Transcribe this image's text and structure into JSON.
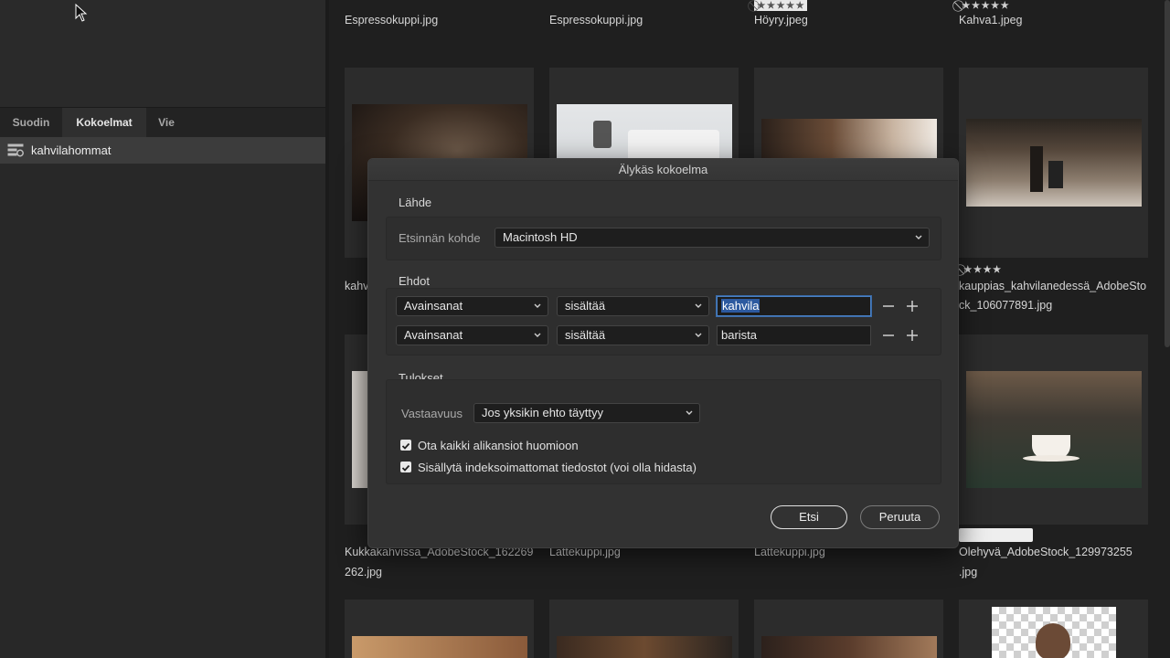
{
  "left_panel": {
    "tabs": [
      "Suodin",
      "Kokoelmat",
      "Vie"
    ],
    "active_tab": "Kokoelmat",
    "collection_item": "kahvilahommat"
  },
  "grid": {
    "row1_names": [
      "Espressokuppi.jpg",
      "Espressokuppi.jpg",
      "Höyry.jpeg",
      "Kahva1.jpeg"
    ],
    "row2_name_col0": "kahv",
    "row2_name_col3_line1": "kauppias_kahvilanedessä_AdobeSto",
    "row2_name_col3_line2": "ck_106077891.jpg",
    "row3_name_col0_line1": "Kukkakahvissa_AdobeStock_162269",
    "row3_name_col0_line2": "262.jpg",
    "row3_name_col1": "Lattekuppi.jpg",
    "row3_name_col2": "Lattekuppi.jpg",
    "row3_name_col3_line1": "Olehyvä_AdobeStock_129973255",
    "row3_name_col3_line2": ".jpg",
    "stars_glyph": "⃠★★★★★",
    "stars_glyph_4": "⃠★★★★"
  },
  "dialog": {
    "title": "Älykäs kokoelma",
    "source_section": "Lähde",
    "search_target_label": "Etsinnän kohde",
    "search_target_value": "Macintosh HD",
    "conditions_section": "Ehdot",
    "conditions": [
      {
        "field": "Avainsanat",
        "operator": "sisältää",
        "value": "kahvila"
      },
      {
        "field": "Avainsanat",
        "operator": "sisältää",
        "value": "barista"
      }
    ],
    "results_section": "Tulokset",
    "match_label": "Vastaavuus",
    "match_value": "Jos yksikin ehto täyttyy",
    "checkbox_subfolders": "Ota kaikki alikansiot huomioon",
    "checkbox_unindexed": "Sisällytä indeksoimattomat tiedostot (voi olla hidasta)",
    "search_button": "Etsi",
    "cancel_button": "Peruuta"
  }
}
